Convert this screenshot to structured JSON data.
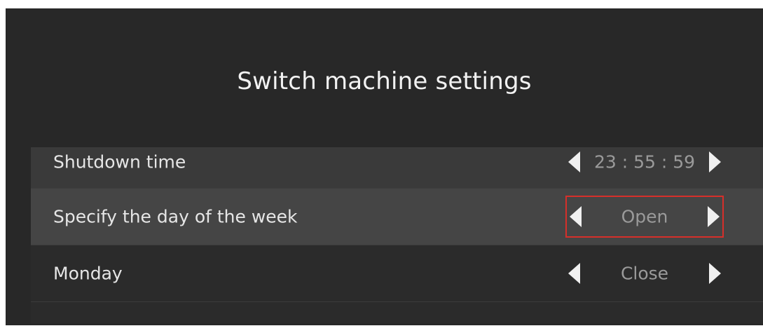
{
  "dialog": {
    "title": "Switch machine settings"
  },
  "rows": [
    {
      "label": "Shutdown time",
      "value": "23 : 55 : 59"
    },
    {
      "label": "Specify the day of the week",
      "value": "Open"
    },
    {
      "label": "Monday",
      "value": "Close"
    }
  ],
  "colors": {
    "background": "#282828",
    "selected_row": "#454545",
    "focus_border": "#d62f2a"
  }
}
